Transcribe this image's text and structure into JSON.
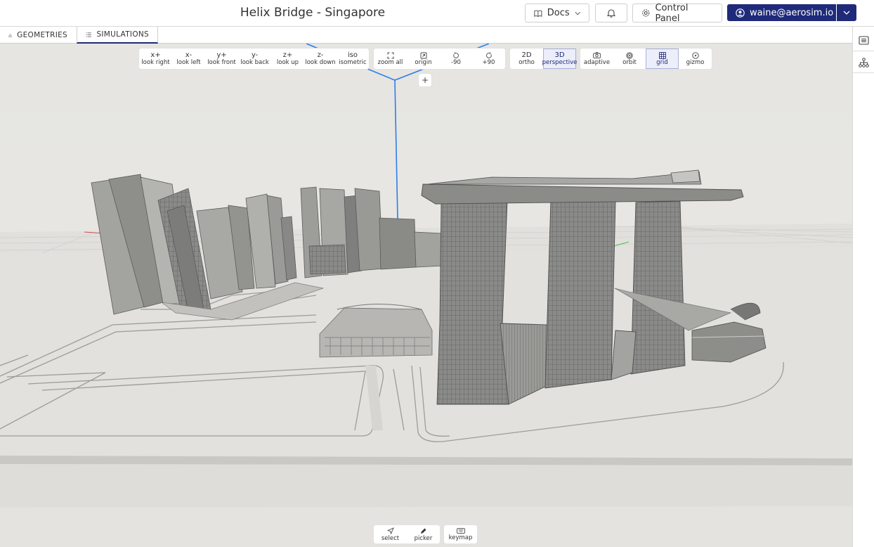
{
  "header": {
    "title": "Helix Bridge - Singapore",
    "docs_label": "Docs",
    "control_panel_label": "Control Panel",
    "user_email": "waine@aerosim.io"
  },
  "tabs": [
    {
      "label": "GEOMETRIES",
      "icon": "geometries-icon"
    },
    {
      "label": "SIMULATIONS",
      "icon": "list-icon",
      "active": true
    }
  ],
  "toolbar": {
    "views": [
      {
        "key": "x+",
        "label": "look right"
      },
      {
        "key": "x-",
        "label": "look left"
      },
      {
        "key": "y+",
        "label": "look front"
      },
      {
        "key": "y-",
        "label": "look back"
      },
      {
        "key": "z+",
        "label": "look up"
      },
      {
        "key": "z-",
        "label": "look down"
      },
      {
        "key": "iso",
        "label": "isometric"
      }
    ],
    "camera": [
      {
        "icon": "zoom-all-icon",
        "label": "zoom all"
      },
      {
        "icon": "origin-icon",
        "label": "origin"
      },
      {
        "icon": "rotate-ccw-icon",
        "label": "-90"
      },
      {
        "icon": "rotate-cw-icon",
        "label": "+90"
      }
    ],
    "projection": [
      {
        "key": "2D",
        "label": "ortho",
        "active": false
      },
      {
        "key": "3D",
        "label": "perspective",
        "active": true
      }
    ],
    "options": [
      {
        "icon": "camera-icon",
        "label": "adaptive",
        "active": false
      },
      {
        "icon": "orbit-icon",
        "label": "orbit",
        "active": false
      },
      {
        "icon": "grid-icon",
        "label": "grid",
        "active": true
      },
      {
        "icon": "gizmo-icon",
        "label": "gizmo",
        "active": false
      }
    ],
    "plus_label": "+"
  },
  "bottom_tools": [
    {
      "icon": "select-cursor-icon",
      "label": "select"
    },
    {
      "icon": "picker-icon",
      "label": "picker"
    },
    {
      "icon": "keyboard-icon",
      "label": "keymap"
    }
  ],
  "colors": {
    "accent": "#1f2a7a",
    "selection_line": "#2f7ee6",
    "building": "#8f8f8c",
    "ground": "#e4e3e0"
  }
}
